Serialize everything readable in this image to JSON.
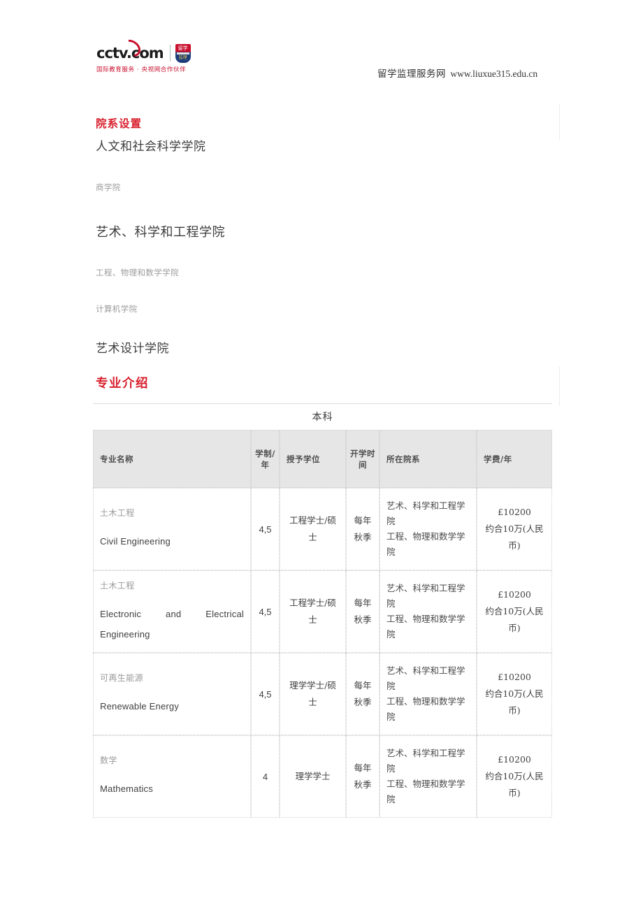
{
  "header": {
    "logo": {
      "wordmark": "cctv.com",
      "badge_top": "留学",
      "badge_bottom": "监理",
      "tagline": "国际教育服务 · 央视网合作伙伴",
      "swoosh_color": "#c8102e",
      "shield_top_color": "#c8102e",
      "shield_bottom_color": "#1d3d7b"
    },
    "credit_cn": "留学监理服务网",
    "credit_url": "www.liuxue315.edu.cn"
  },
  "sections": {
    "departments": {
      "title": "院系设置",
      "title_color": "#d81e2c",
      "items": [
        {
          "label": "人文和社会科学学院",
          "emphasis": "big"
        },
        {
          "label": "商学院",
          "emphasis": "small"
        },
        {
          "label": "艺术、科学和工程学院",
          "emphasis": "big"
        },
        {
          "label": "工程、物理和数学学院",
          "emphasis": "small"
        },
        {
          "label": "计算机学院",
          "emphasis": "small"
        },
        {
          "label": "艺术设计学院",
          "emphasis": "big"
        }
      ]
    },
    "majors": {
      "title": "专业介绍",
      "title_color": "#d81e2c",
      "table_caption": "本科",
      "headers": [
        "专业名称",
        "学制/年",
        "授予学位",
        "开学时间",
        "所在院系",
        "学费/年"
      ],
      "rows": [
        {
          "name_cn": "土木工程",
          "name_en": "Civil Engineering",
          "years": "4,5",
          "degree": "工程学士/硕士",
          "term": "每年秋季",
          "school": "艺术、科学和工程学院\n工程、物理和数学学院",
          "school_line1": "艺术、科学和工程学院",
          "school_line2": "工程、物理和数学学院",
          "fee_amount": "£10200",
          "fee_note": "约合10万(人民币)"
        },
        {
          "name_cn": "土木工程",
          "name_en": "Electronic and Electrical Engineering",
          "years": "4,5",
          "degree": "工程学士/硕士",
          "term": "每年秋季",
          "school_line1": "艺术、科学和工程学院",
          "school_line2": "工程、物理和数学学院",
          "fee_amount": "£10200",
          "fee_note": "约合10万(人民币)"
        },
        {
          "name_cn": "可再生能源",
          "name_en": "Renewable Energy",
          "years": "4,5",
          "degree": "理学学士/硕士",
          "term": "每年秋季",
          "school_line1": "艺术、科学和工程学院",
          "school_line2": "工程、物理和数学学院",
          "fee_amount": "£10200",
          "fee_note": "约合10万(人民币)"
        },
        {
          "name_cn": "数学",
          "name_en": "Mathematics",
          "years": "4",
          "degree": "理学学士",
          "term": "每年秋季",
          "school_line1": "艺术、科学和工程学院",
          "school_line2": "工程、物理和数学学院",
          "fee_amount": "£10200",
          "fee_note": "约合10万(人民币)"
        }
      ]
    }
  }
}
